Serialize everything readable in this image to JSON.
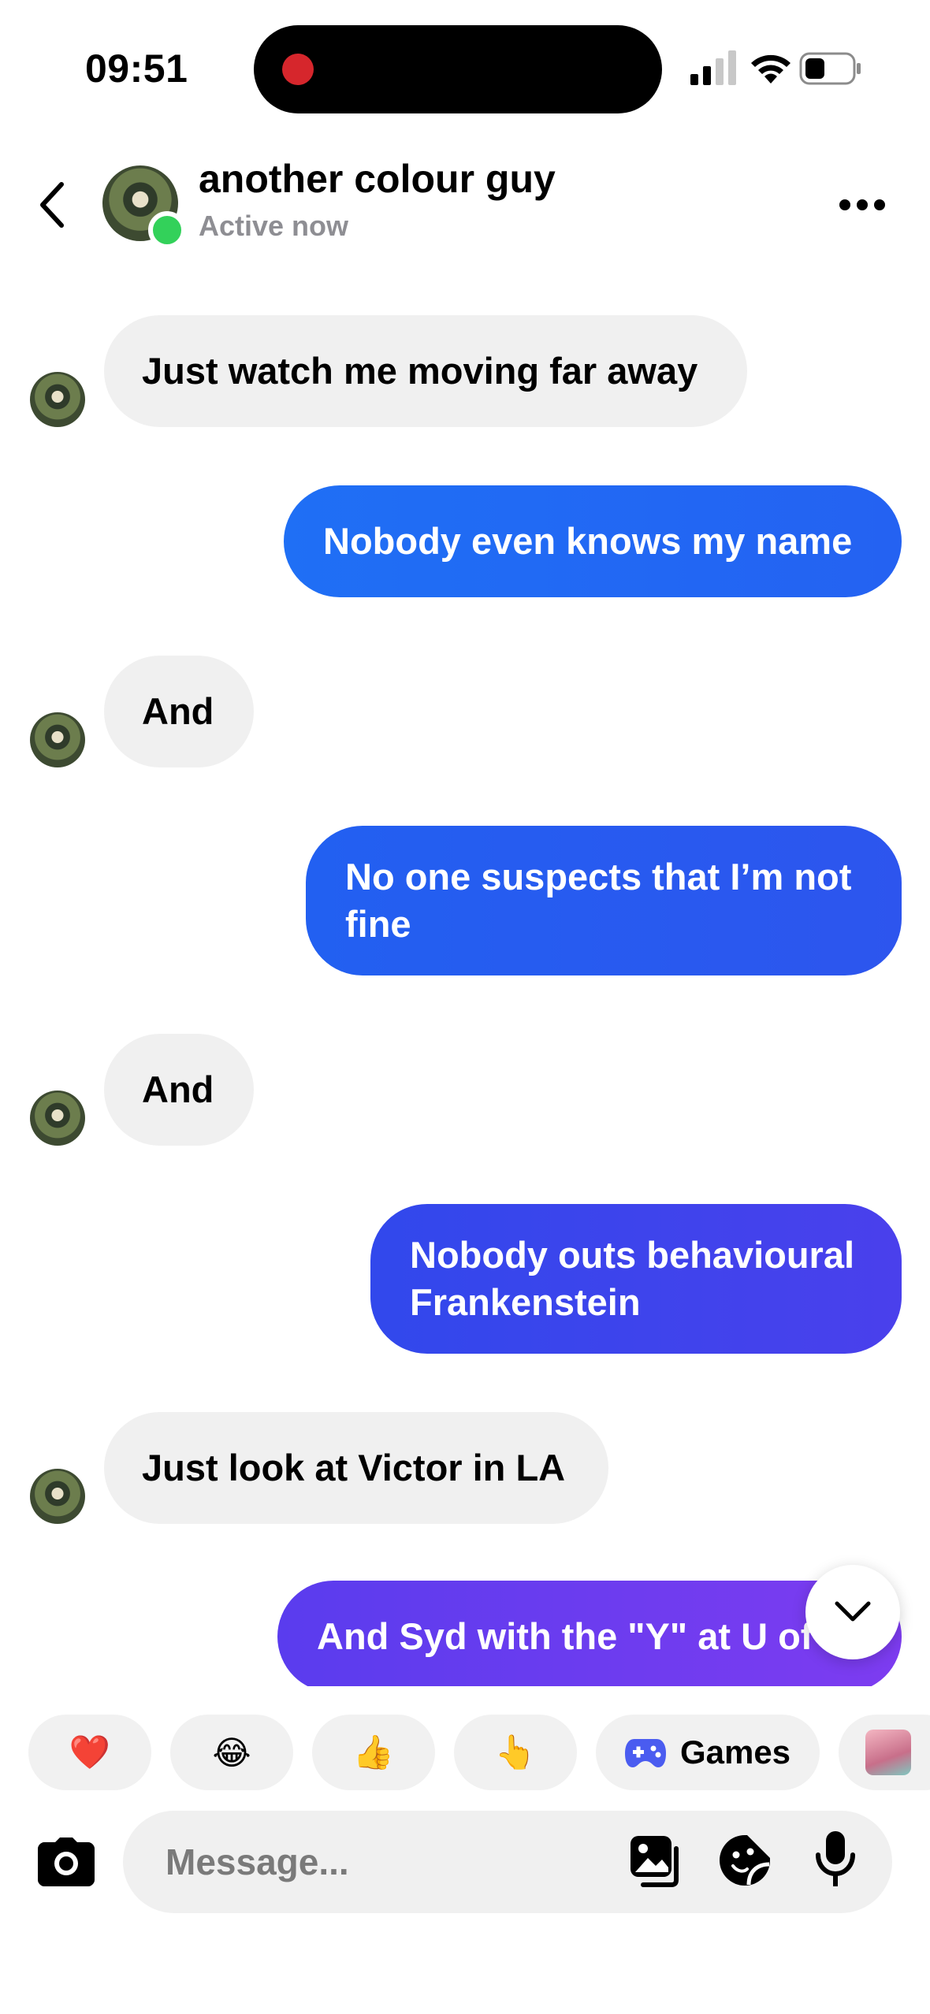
{
  "status_bar": {
    "time": "09:51"
  },
  "header": {
    "contact_name": "another colour guy",
    "status": "Active now"
  },
  "messages": [
    {
      "side": "in",
      "text": "Just watch me moving far away"
    },
    {
      "side": "out",
      "text": "Nobody even knows my name"
    },
    {
      "side": "in",
      "text": "And"
    },
    {
      "side": "out",
      "text": "No one suspects that I’m not fine"
    },
    {
      "side": "in",
      "text": "And"
    },
    {
      "side": "out",
      "text": "Nobody outs behavioural Frankenstein"
    },
    {
      "side": "in",
      "text": "Just look at Victor in LA"
    },
    {
      "side": "out",
      "text": "And Syd with the \"Y\" at U of"
    }
  ],
  "quick_replies": {
    "heart": "❤️",
    "laugh": "😂",
    "thumbs_up": "👍",
    "point": "👆",
    "games_label": "Games"
  },
  "composer": {
    "placeholder": "Message..."
  },
  "colors": {
    "outgoing_start": "#1f6ff5",
    "outgoing_end": "#7d3cf0",
    "incoming_bg": "#f0f0f0",
    "online": "#33d15a"
  }
}
